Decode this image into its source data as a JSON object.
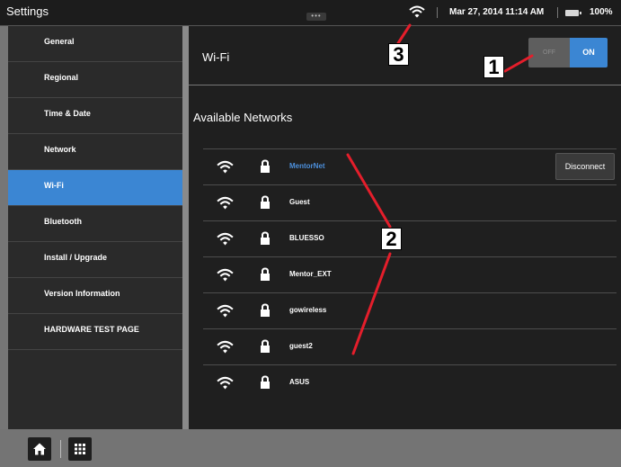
{
  "status_bar": {
    "app_title": "Settings",
    "datetime": "Mar 27, 2014 11:14 AM",
    "battery": "100%"
  },
  "sidebar": {
    "items": [
      {
        "label": "General"
      },
      {
        "label": "Regional"
      },
      {
        "label": "Time & Date"
      },
      {
        "label": "Network"
      },
      {
        "label": "Wi-Fi",
        "active": true
      },
      {
        "label": "Bluetooth"
      },
      {
        "label": "Install / Upgrade"
      },
      {
        "label": "Version Information"
      },
      {
        "label": "HARDWARE TEST PAGE"
      }
    ]
  },
  "main": {
    "title": "Wi-Fi",
    "toggle": {
      "off_label": "OFF",
      "on_label": "ON",
      "state": "on"
    },
    "section_title": "Available Networks",
    "networks": [
      {
        "name": "MentorNet",
        "connected": true,
        "action": "Disconnect"
      },
      {
        "name": "Guest"
      },
      {
        "name": "BLUESSO"
      },
      {
        "name": "Mentor_EXT"
      },
      {
        "name": "gowireless"
      },
      {
        "name": "guest2"
      },
      {
        "name": "ASUS"
      }
    ]
  },
  "callouts": [
    "1",
    "2",
    "3"
  ],
  "colors": {
    "accent": "#3b86d3",
    "connected_text": "#4c8fdb",
    "callout_line": "#e41e2b"
  },
  "icons": [
    "wifi-icon",
    "lock-icon",
    "battery-icon",
    "home-icon",
    "apps-grid-icon"
  ]
}
